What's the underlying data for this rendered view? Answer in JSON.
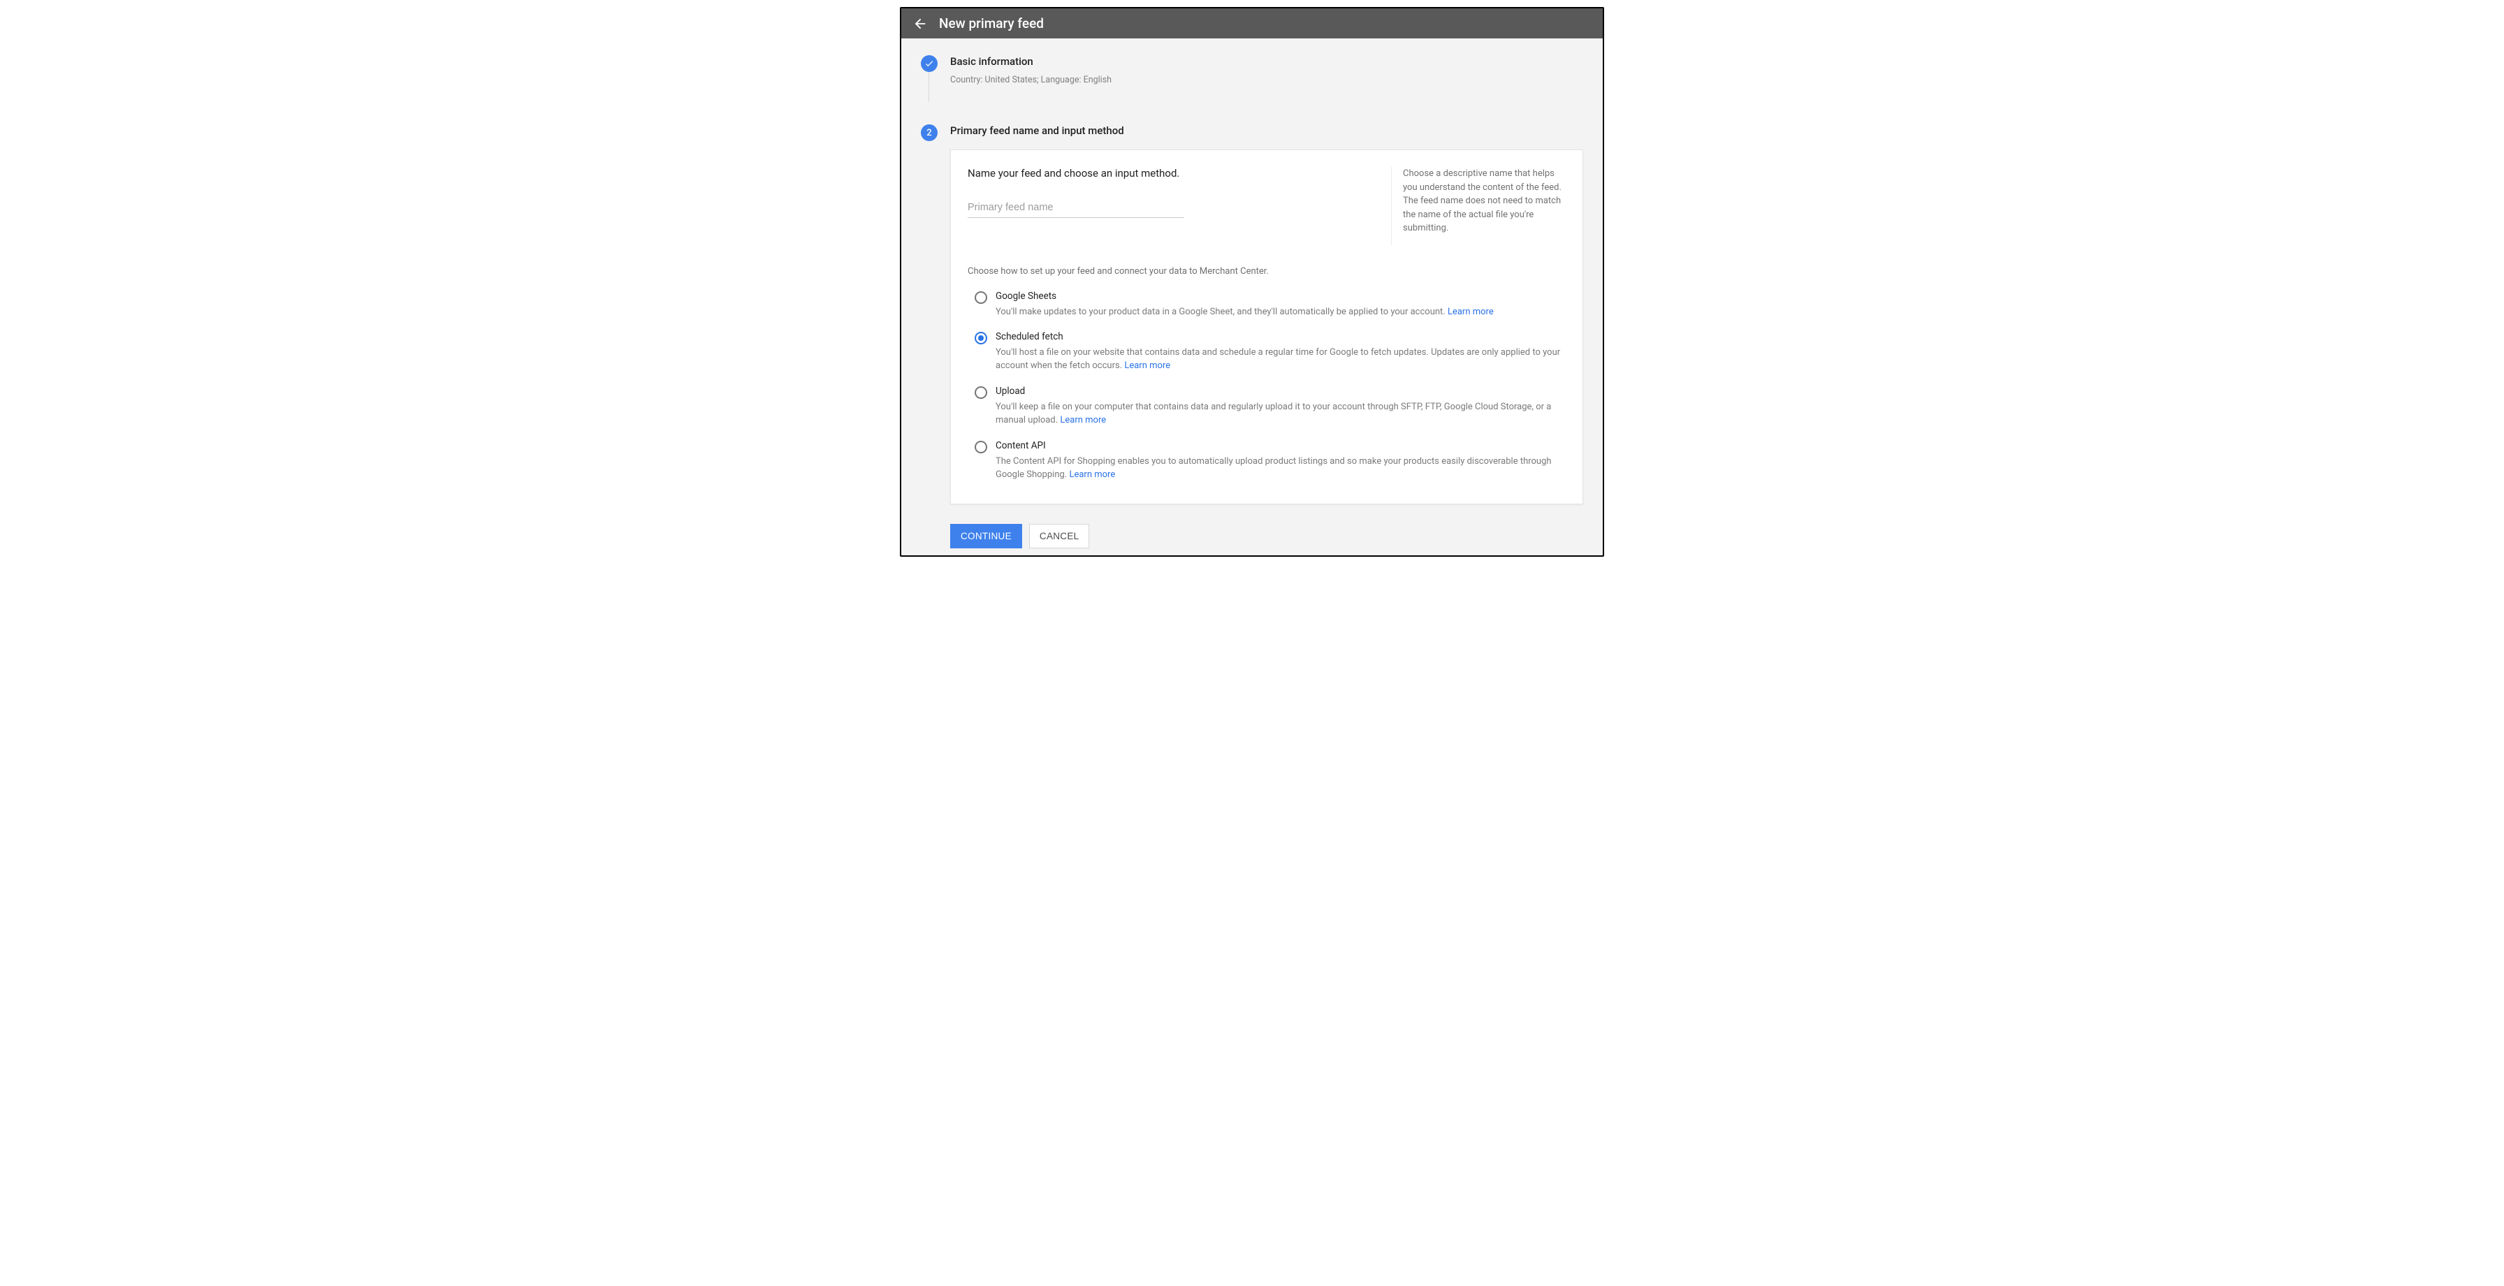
{
  "header": {
    "title": "New primary feed"
  },
  "step1": {
    "title": "Basic information",
    "subtitle": "Country: United States; Language: English"
  },
  "step2": {
    "number": "2",
    "title": "Primary feed name and input method"
  },
  "card": {
    "prompt": "Name your feed and choose an input method.",
    "placeholder": "Primary feed name",
    "help": "Choose a descriptive name that helps you understand the content of the feed. The feed name does not need to match the name of the actual file you're submitting.",
    "choose_text": "Choose how to set up your feed and connect your data to Merchant Center.",
    "options": [
      {
        "title": "Google Sheets",
        "desc": "You'll make updates to your product data in a Google Sheet, and they'll automatically be applied to your account. ",
        "learn": "Learn more",
        "selected": false
      },
      {
        "title": "Scheduled fetch",
        "desc": "You'll host a file on your website that contains data and schedule a regular time for Google to fetch updates. Updates are only applied to your account when the fetch occurs. ",
        "learn": "Learn more",
        "selected": true
      },
      {
        "title": "Upload",
        "desc": "You'll keep a file on your computer that contains data and regularly upload it to your account through SFTP, FTP, Google Cloud Storage, or a manual upload. ",
        "learn": "Learn more",
        "selected": false
      },
      {
        "title": "Content API",
        "desc": "The Content API for Shopping enables you to automatically upload product listings and so make your products easily discoverable through Google Shopping. ",
        "learn": "Learn more",
        "selected": false
      }
    ]
  },
  "actions": {
    "continue": "CONTINUE",
    "cancel": "CANCEL"
  }
}
